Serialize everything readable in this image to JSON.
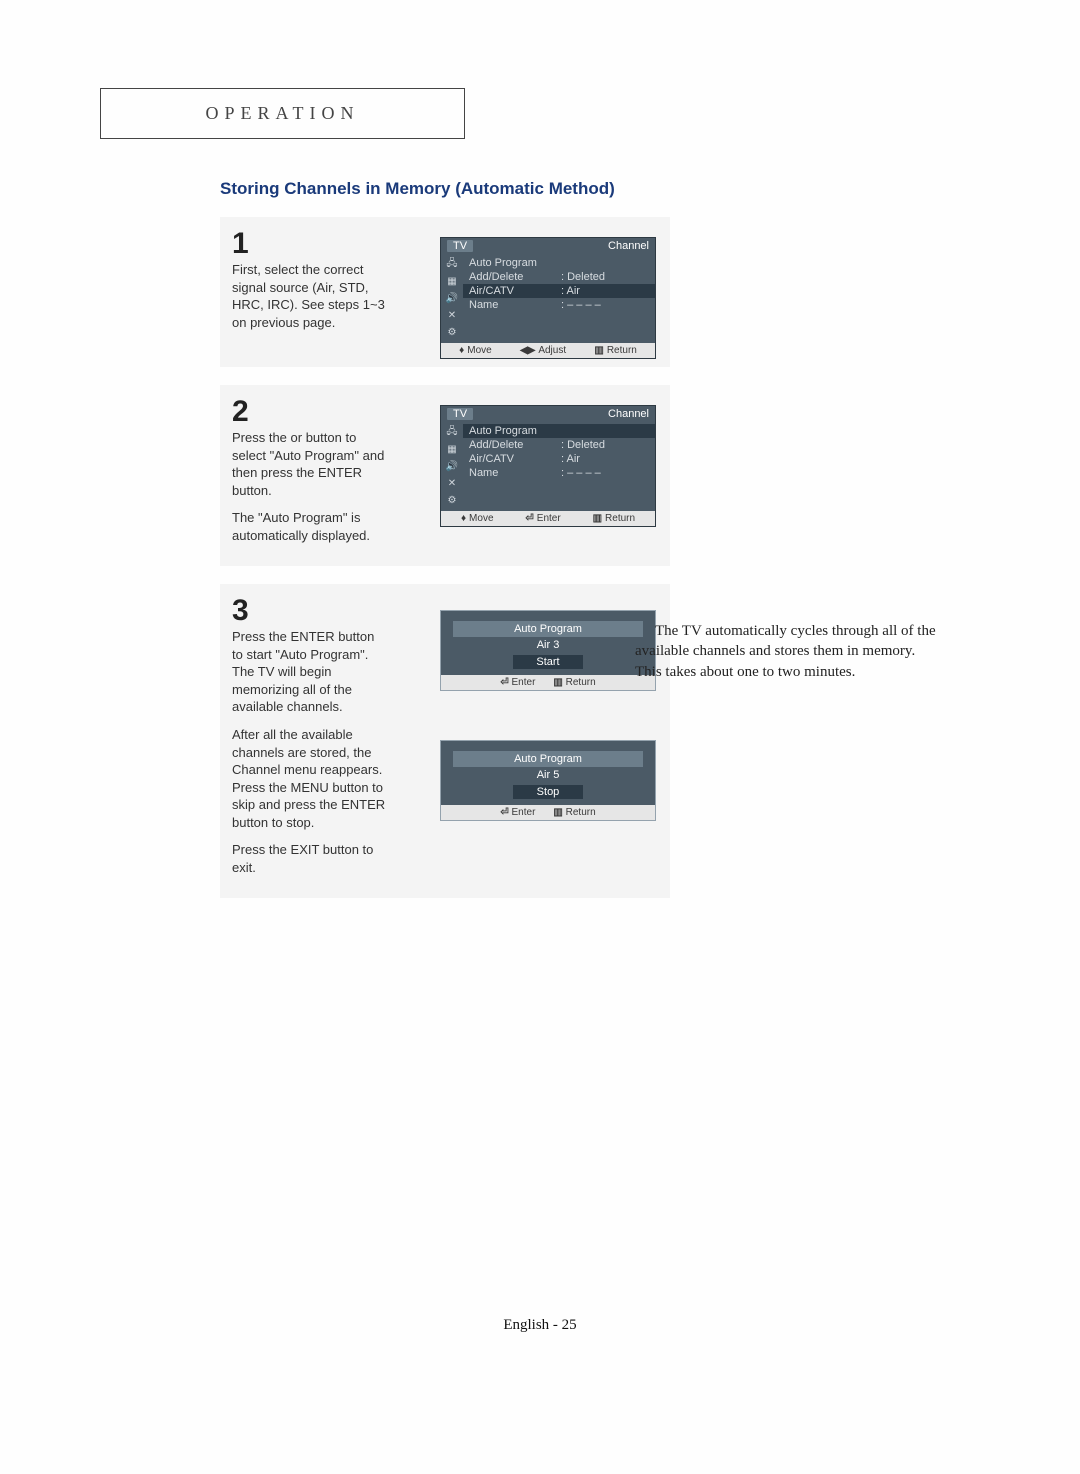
{
  "header": {
    "title": "OPERATION"
  },
  "subtitle": "Storing Channels in Memory (Automatic Method)",
  "steps": {
    "s1": {
      "num": "1",
      "text": "First, select the correct signal source (Air, STD, HRC, IRC). See steps 1~3 on previous page.",
      "osd": {
        "tv": "TV",
        "headright": "Channel",
        "rows": {
          "r1": {
            "k": "Auto Program",
            "v": ""
          },
          "r2": {
            "k": "Add/Delete",
            "v": ":  Deleted"
          },
          "r3": {
            "k": "Air/CATV",
            "v": ":  Air"
          },
          "r4": {
            "k": "Name",
            "v": ":  – – – –"
          }
        },
        "foot": {
          "f1": "Move",
          "f2": "Adjust",
          "f3": "Return"
        }
      }
    },
    "s2": {
      "num": "2",
      "text1": "Press the      or      button to select \"Auto Program\" and then press the ENTER button.",
      "text2": "The \"Auto Program\" is automatically displayed.",
      "osd": {
        "tv": "TV",
        "headright": "Channel",
        "rows": {
          "r1": {
            "k": "Auto Program",
            "v": ""
          },
          "r2": {
            "k": "Add/Delete",
            "v": ":  Deleted"
          },
          "r3": {
            "k": "Air/CATV",
            "v": ":  Air"
          },
          "r4": {
            "k": "Name",
            "v": ":  – – – –"
          }
        },
        "foot": {
          "f1": "Move",
          "f2": "Enter",
          "f3": "Return"
        }
      }
    },
    "s3": {
      "num": "3",
      "text1": "Press the ENTER button to start \"Auto Program\". The TV will begin memorizing all of the available channels.",
      "text2": "After all the available channels are stored, the Channel menu reappears. Press the MENU button to skip and press the ENTER button to stop.",
      "text3": "Press the EXIT button to exit.",
      "popup1": {
        "title": "Auto Program",
        "line": "Air    3",
        "btn": "Start",
        "foot": {
          "f1": "Enter",
          "f2": "Return"
        }
      },
      "popup2": {
        "title": "Auto Program",
        "line": "Air    5",
        "btn": "Stop",
        "foot": {
          "f1": "Enter",
          "f2": "Return"
        }
      }
    }
  },
  "sidenote": {
    "p1": "The TV automatically cycles through all of the available channels and stores them in memory.",
    "p2": "This takes about one to two minutes."
  },
  "footer": "English - 25",
  "icons": {
    "updown": "◆",
    "leftright": "◀▶",
    "enter": "⏎",
    "menu": "▥"
  }
}
